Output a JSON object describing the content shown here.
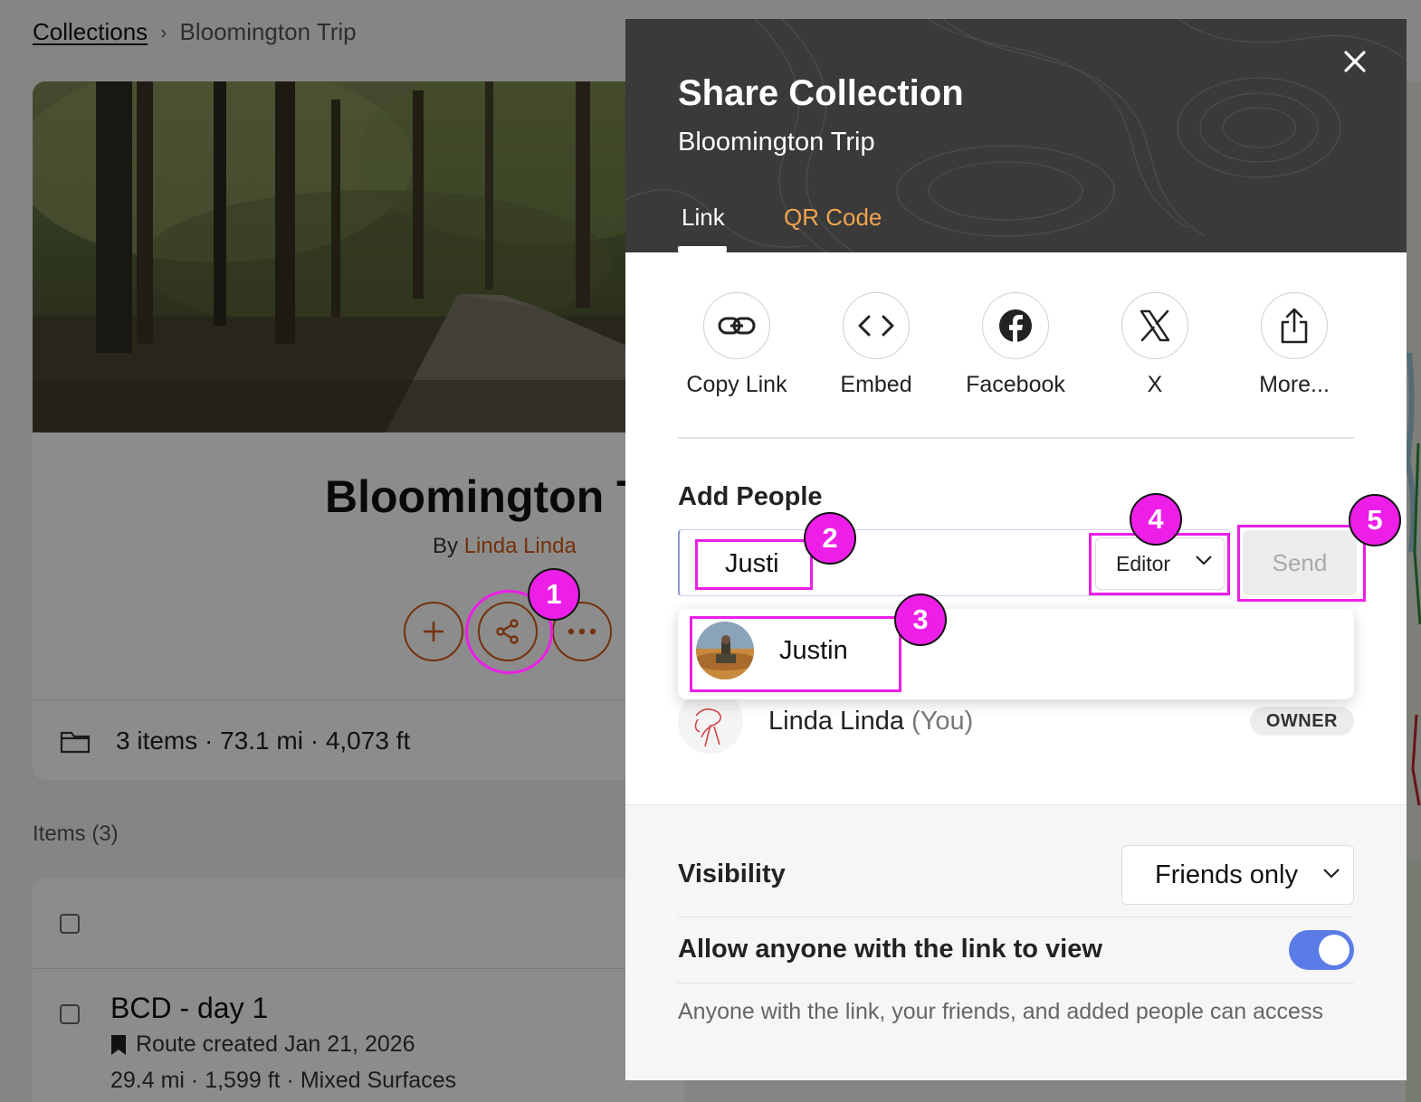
{
  "breadcrumb": {
    "root": "Collections",
    "separator": "›",
    "current": "Bloomington Trip"
  },
  "collection": {
    "title": "Bloomington T",
    "by_prefix": "By",
    "author": "Linda Linda",
    "stats": "3 items · 73.1 mi · 4,073 ft",
    "actions": [
      "plus-icon",
      "share-icon",
      "more-icon"
    ]
  },
  "items": {
    "label": "Items (3)",
    "first_item": {
      "title": "BCD - day 1",
      "subtitle": "Route created Jan 21, 2026",
      "meta": "29.4 mi · 1,599 ft · Mixed Surfaces"
    }
  },
  "modal": {
    "title": "Share Collection",
    "subtitle": "Bloomington Trip",
    "tabs": [
      {
        "label": "Link",
        "active": true
      },
      {
        "label": "QR Code",
        "active": false
      }
    ],
    "share_options": [
      {
        "label": "Copy Link",
        "icon": "link-icon"
      },
      {
        "label": "Embed",
        "icon": "code-icon"
      },
      {
        "label": "Facebook",
        "icon": "facebook-icon"
      },
      {
        "label": "X",
        "icon": "x-logo-icon"
      },
      {
        "label": "More...",
        "icon": "share-upload-icon"
      }
    ],
    "add_people": {
      "title": "Add People",
      "input_value": "Justi",
      "role": "Editor",
      "send_label": "Send",
      "suggestion": "Justin"
    },
    "members": [
      {
        "name": "Linda Linda",
        "suffix": "(You)",
        "badge": "OWNER"
      }
    ],
    "visibility": {
      "label": "Visibility",
      "value": "Friends only"
    },
    "link_access": {
      "label": "Allow anyone with the link to view",
      "enabled": true,
      "help": "Anyone with the link, your friends, and added people can access"
    }
  },
  "annotations": [
    "1",
    "2",
    "3",
    "4",
    "5"
  ],
  "colors": {
    "accent_orange": "#d35a17",
    "tab_inactive": "#f0a550",
    "toggle_on": "#5b7ce6",
    "annotation": "#ec1ee8"
  }
}
